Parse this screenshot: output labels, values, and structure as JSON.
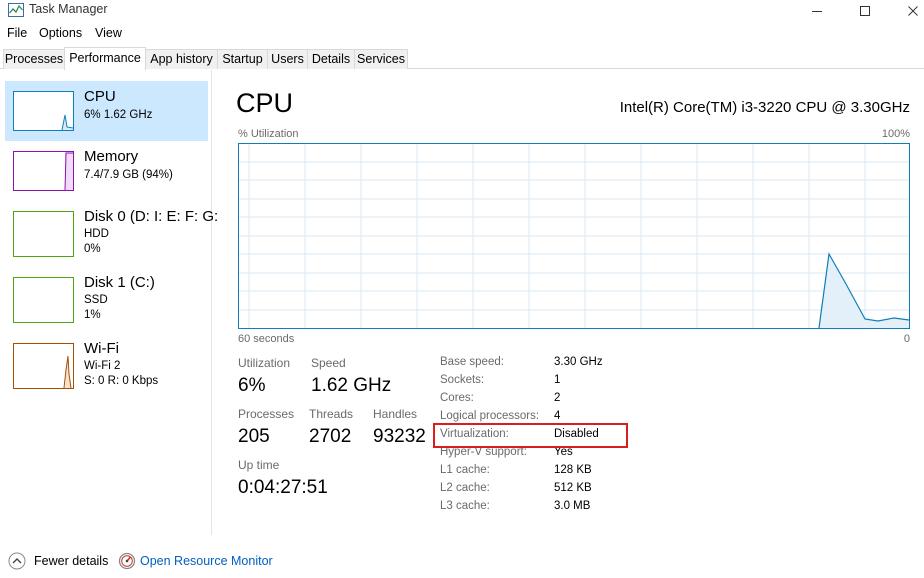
{
  "window": {
    "title": "Task Manager"
  },
  "menu": [
    "File",
    "Options",
    "View"
  ],
  "tabs": [
    "Processes",
    "Performance",
    "App history",
    "Startup",
    "Users",
    "Details",
    "Services"
  ],
  "active_tab": "Performance",
  "sidebar": {
    "items": [
      {
        "name": "CPU",
        "line1": "6%  1.62 GHz",
        "line2": "",
        "color": "#117dbb"
      },
      {
        "name": "Memory",
        "line1": "7.4/7.9 GB (94%)",
        "line2": "",
        "color": "#8b12ae"
      },
      {
        "name": "Disk 0 (D: I: E: F: G:",
        "line1": "HDD",
        "line2": "0%",
        "color": "#4da60c"
      },
      {
        "name": "Disk 1 (C:)",
        "line1": "SSD",
        "line2": "1%",
        "color": "#4da60c"
      },
      {
        "name": "Wi-Fi",
        "line1": "Wi-Fi 2",
        "line2": "S: 0  R: 0 Kbps",
        "color": "#a74f01"
      }
    ]
  },
  "main": {
    "title": "CPU",
    "model": "Intel(R) Core(TM) i3-3220 CPU @ 3.30GHz",
    "graph_top_left": "% Utilization",
    "graph_top_right": "100%",
    "graph_bottom_left": "60 seconds",
    "graph_bottom_right": "0",
    "graph_color": "#117dbb"
  },
  "stats": {
    "utilization_label": "Utilization",
    "utilization_value": "6%",
    "speed_label": "Speed",
    "speed_value": "1.62 GHz",
    "processes_label": "Processes",
    "processes_value": "205",
    "threads_label": "Threads",
    "threads_value": "2702",
    "handles_label": "Handles",
    "handles_value": "93232",
    "uptime_label": "Up time",
    "uptime_value": "0:04:27:51"
  },
  "specs": [
    {
      "label": "Base speed:",
      "value": "3.30 GHz"
    },
    {
      "label": "Sockets:",
      "value": "1"
    },
    {
      "label": "Cores:",
      "value": "2"
    },
    {
      "label": "Logical processors:",
      "value": "4"
    },
    {
      "label": "Virtualization:",
      "value": "Disabled"
    },
    {
      "label": "Hyper-V support:",
      "value": "Yes"
    },
    {
      "label": "L1 cache:",
      "value": "128 KB"
    },
    {
      "label": "L2 cache:",
      "value": "512 KB"
    },
    {
      "label": "L3 cache:",
      "value": "3.0 MB"
    }
  ],
  "footer": {
    "fewer_details": "Fewer details",
    "open_resource_monitor": "Open Resource Monitor"
  }
}
